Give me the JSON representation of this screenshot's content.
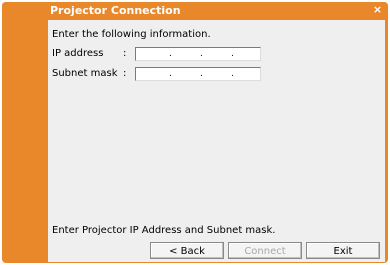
{
  "window": {
    "title": "Projector Connection",
    "close_symbol": "×"
  },
  "form": {
    "prompt": "Enter the following information.",
    "ip_label": "IP address",
    "subnet_label": "Subnet mask",
    "colon": ":",
    "ip_value": [
      "",
      "",
      "",
      ""
    ],
    "subnet_value": [
      "",
      "",
      "",
      ""
    ],
    "separator": "."
  },
  "status_text": "Enter Projector IP Address and Subnet mask.",
  "buttons": {
    "back": "< Back",
    "connect": "Connect",
    "exit": "Exit",
    "connect_enabled": false
  },
  "colors": {
    "accent": "#e8882a",
    "client_bg": "#efefef"
  }
}
